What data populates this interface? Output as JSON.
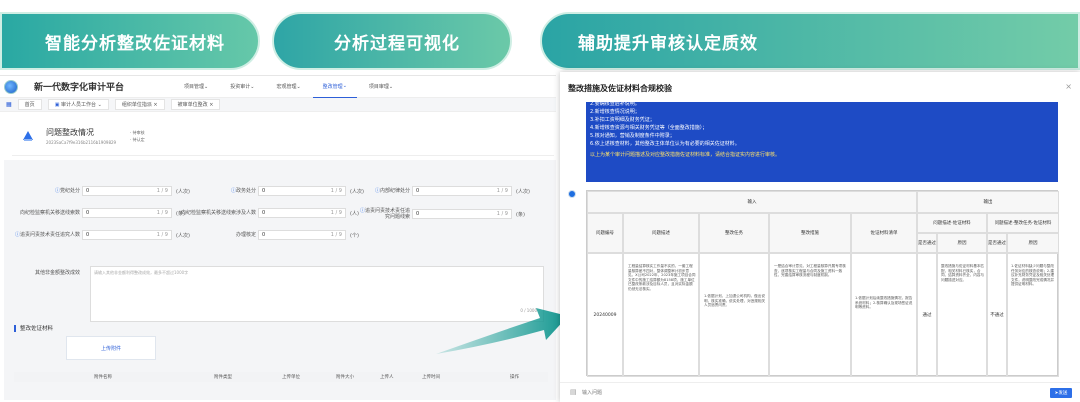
{
  "banners": [
    "智能分析整改佐证材料",
    "分析过程可视化",
    "辅助提升审核认定质效"
  ],
  "app": {
    "title": "新一代数字化审计平台",
    "nav": [
      "项目管理",
      "投资审计",
      "宏观管理",
      "整改管理",
      "项目审理"
    ],
    "active_nav": 3
  },
  "tabs": [
    "首页",
    "审计人员工作台",
    "组织单位指派",
    "被审单位整改"
  ],
  "card": {
    "title": "问题整改情况",
    "subtitle": "2023SaCa7f9e316b2116b1909829",
    "stats": [
      "· 待审核",
      "· 待认定"
    ]
  },
  "form": {
    "row1": [
      {
        "label": "党纪处分",
        "value": "0",
        "count": "1 / 9",
        "unit": "(人次)"
      },
      {
        "label": "政务处分",
        "value": "0",
        "count": "1 / 9",
        "unit": "(人次)"
      },
      {
        "label": "内部纪律处分",
        "value": "0",
        "count": "1 / 9",
        "unit": "(人次)"
      }
    ],
    "row2": [
      {
        "label": "向纪检监察机关移送线索数",
        "value": "0",
        "count": "1 / 9",
        "unit": "(条)"
      },
      {
        "label": "向纪检监察机关移送线索涉及人数",
        "value": "0",
        "count": "1 / 9",
        "unit": "(人)"
      },
      {
        "label": "追责问责技术责任追究问题线索",
        "value": "0",
        "count": "1 / 9",
        "unit": "(条)"
      }
    ],
    "row3": [
      {
        "label": "追责问责技术责任追究人数",
        "value": "0",
        "count": "1 / 9",
        "unit": "(人次)"
      },
      {
        "label": "办理核定",
        "value": "0",
        "count": "1 / 9",
        "unit": "(个)"
      }
    ],
    "other_label": "其他非金额整改成效",
    "other_placeholder": "请输入其他非金额利得整改成效，最多不超过1000字",
    "other_count": "0 / 1000"
  },
  "evidence": {
    "title": "整改佐证材料",
    "upload": "上传附件",
    "columns": [
      "附件名称",
      "附件类型",
      "上传单位",
      "附件大小",
      "上传人",
      "上传时间",
      "操作"
    ]
  },
  "modal": {
    "title": "整改措施及佐证材料合规校验",
    "close": "×",
    "notes": [
      "2.要确核查后补说明。",
      "2.新增核查情况说明；",
      "3.补扣工资明细及财务凭证；",
      "4.新增核查资源与相关财务凭证等（全面整改措施）；",
      "5.核对通知，营销及制度条件中附录；",
      "6.依上述核查材料，其他整改主体单位认为有必要的相关佐证材料。"
    ],
    "footnote": "以上为某个审计问题描述及对应整改措施佐证材料标准，请结合指证实内容进行审核。",
    "input_header": "输入",
    "output_header": "输出",
    "cols": [
      "问题编号",
      "问题描述",
      "整改任务",
      "整改措施",
      "佐证材料清单"
    ],
    "out_groups": [
      "问题描述·佐证材料",
      "问题描述·整改任务·佐证材料"
    ],
    "out_sub": [
      "是否通过",
      "原因",
      "是否通过",
      "原因"
    ],
    "row": {
      "id": "20240009",
      "desc": "工程量结算核实工作量不实的，一套工程量核算差不四对，整体调整审计初步意见。X公司2022年，2023年施工项目合同文件中的施工结算额为8158项，施工单位已整改条款涉及目标人员，且对实际金额仍然无法核实。",
      "task": "1.依据计划，上加退公司机构，做出说明，核实准确，依实处理，对违规相关人员追责问责。",
      "measure": "一是结合审计意见，对工程量核算开展专项核查，逐项核实工程量与合同及施工资料一致性，完善结算审核流程与制度机制。",
      "evidence": "1.依据计划后续整改措施情况，报告系统材料；2.核算确认及现场签证说明等资料。",
      "pass1": "通过",
      "reason1": "整改措施与佐证材料基本匹配，相关材料已核实，合同、结算资料齐全，内容与问题描述对应。",
      "pass2": "不通过",
      "reason2": "1.佐证材料缺少问题与整改任务对应的核查说明；2.建议补充财务凭证及相关处理文件，说明整改完成情况并提供证明材料。"
    },
    "footer_label": "输入问题",
    "submit": "发送"
  }
}
